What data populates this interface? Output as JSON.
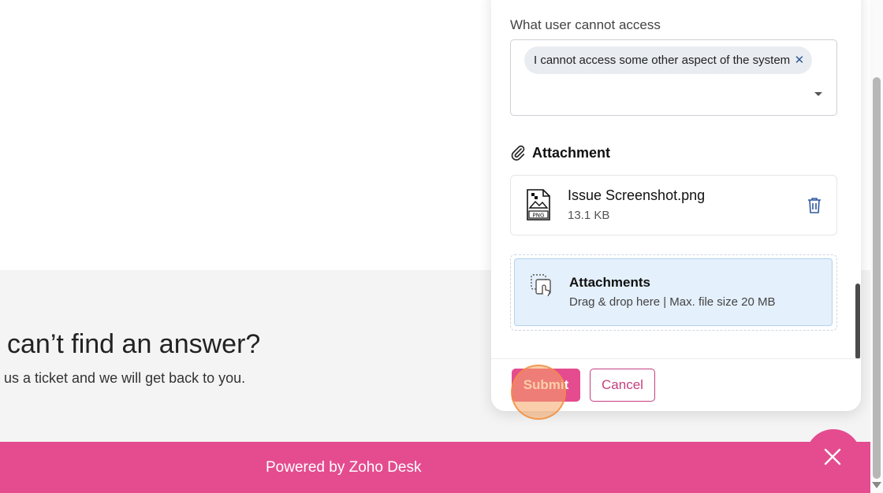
{
  "background": {
    "heading": "l can’t find an answer?",
    "subtext": "l us a ticket and we will get back to you.",
    "footer_text": "Powered by Zoho Desk"
  },
  "form": {
    "field_label": "What user cannot access",
    "selected_chip": "I cannot access some other aspect of the system",
    "chip_close": "✕",
    "attachment_title": "Attachment",
    "file": {
      "name": "Issue Screenshot.png",
      "size": "13.1 KB",
      "type_badge": "PNG"
    },
    "dropzone": {
      "title": "Attachments",
      "subtitle": "Drag & drop here | Max. file size 20 MB"
    },
    "submit_label": "Submit",
    "cancel_label": "Cancel"
  },
  "colors": {
    "brand": "#e44c8f",
    "dropzone_bg": "#e4f0fc",
    "chip_bg": "#e9ecf0"
  },
  "icons": {
    "attachment": "paperclip-icon",
    "file": "png-file-icon",
    "delete": "trash-icon",
    "upload": "drag-drop-icon",
    "close_widget": "close-icon"
  }
}
